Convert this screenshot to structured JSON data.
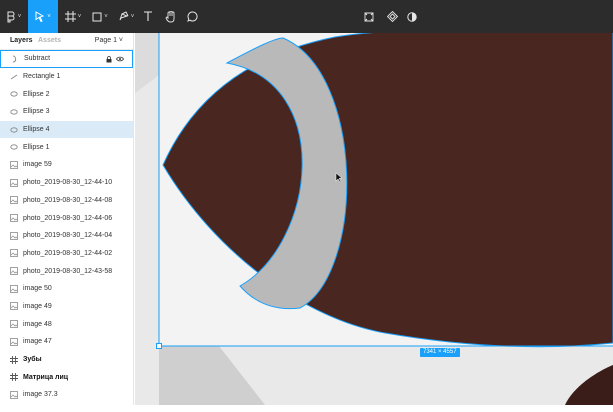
{
  "toolbar": {
    "tools": [
      {
        "name": "main-menu",
        "icon": "figma-menu-icon"
      },
      {
        "name": "move-tool",
        "icon": "pointer-icon",
        "active": true
      },
      {
        "name": "frame-tool",
        "icon": "frame-icon"
      },
      {
        "name": "shape-tool",
        "icon": "rectangle-icon"
      },
      {
        "name": "pen-tool",
        "icon": "pen-icon"
      },
      {
        "name": "text-tool",
        "icon": "text-icon"
      },
      {
        "name": "hand-tool",
        "icon": "hand-icon"
      },
      {
        "name": "comment-tool",
        "icon": "comment-icon"
      }
    ],
    "center_tools": [
      "component-icon",
      "boolean-icon",
      "contrast-icon"
    ],
    "accent": "#18a0fb"
  },
  "left_panel": {
    "tab_layers": "Layers",
    "tab_assets": "Assets",
    "page_label": "Page 1 ˅",
    "layers": [
      {
        "label": "Subtract",
        "icon": "subtract-icon",
        "state": "selected-outline"
      },
      {
        "label": "Rectangle 1",
        "icon": "rectangle-layer-icon"
      },
      {
        "label": "Ellipse 2",
        "icon": "ellipse-layer-icon"
      },
      {
        "label": "Ellipse 3",
        "icon": "ellipse-layer-icon"
      },
      {
        "label": "Ellipse 4",
        "icon": "ellipse-layer-icon",
        "state": "highlight"
      },
      {
        "label": "Ellipse 1",
        "icon": "ellipse-layer-icon"
      },
      {
        "label": "image 59",
        "icon": "image-layer-icon"
      },
      {
        "label": "photo_2019-08-30_12-44-10",
        "icon": "image-layer-icon"
      },
      {
        "label": "photo_2019-08-30_12-44-08",
        "icon": "image-layer-icon"
      },
      {
        "label": "photo_2019-08-30_12-44-06",
        "icon": "image-layer-icon"
      },
      {
        "label": "photo_2019-08-30_12-44-04",
        "icon": "image-layer-icon"
      },
      {
        "label": "photo_2019-08-30_12-44-02",
        "icon": "image-layer-icon"
      },
      {
        "label": "photo_2019-08-30_12-43-58",
        "icon": "image-layer-icon"
      },
      {
        "label": "image 50",
        "icon": "image-layer-icon"
      },
      {
        "label": "image 49",
        "icon": "image-layer-icon"
      },
      {
        "label": "image 48",
        "icon": "image-layer-icon"
      },
      {
        "label": "image 47",
        "icon": "image-layer-icon"
      },
      {
        "label": "Зубы",
        "icon": "frame-layer-icon",
        "kind": "frame"
      },
      {
        "label": "Матрица лиц",
        "icon": "frame-layer-icon",
        "kind": "frame"
      },
      {
        "label": "image 37.3",
        "icon": "image-layer-icon"
      }
    ]
  },
  "canvas": {
    "size_badge": "7341 × 4557",
    "shape_color": "#4a2620",
    "crescent_color": "#b9b9b9",
    "selection_color": "#18a0fb"
  }
}
